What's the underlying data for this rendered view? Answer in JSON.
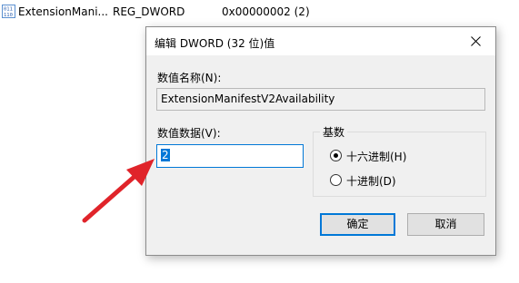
{
  "registry_row": {
    "icon": "registry-binary-value-icon",
    "name": "ExtensionMani...",
    "type": "REG_DWORD",
    "data": "0x00000002 (2)"
  },
  "dialog": {
    "title": "编辑 DWORD (32 位)值",
    "close_icon": "close-icon",
    "value_name_label": "数值名称(N):",
    "value_name": "ExtensionManifestV2Availability",
    "value_data_label": "数值数据(V):",
    "value_data": "2",
    "base_group": {
      "title": "基数",
      "options": [
        {
          "label": "十六进制(H)",
          "selected": true
        },
        {
          "label": "十进制(D)",
          "selected": false
        }
      ]
    },
    "ok_label": "确定",
    "cancel_label": "取消"
  },
  "annotation": {
    "arrow_icon": "red-arrow-icon",
    "color": "#e0242a"
  },
  "colors": {
    "accent": "#0078d7",
    "dialog_bg": "#f0f0f0"
  }
}
